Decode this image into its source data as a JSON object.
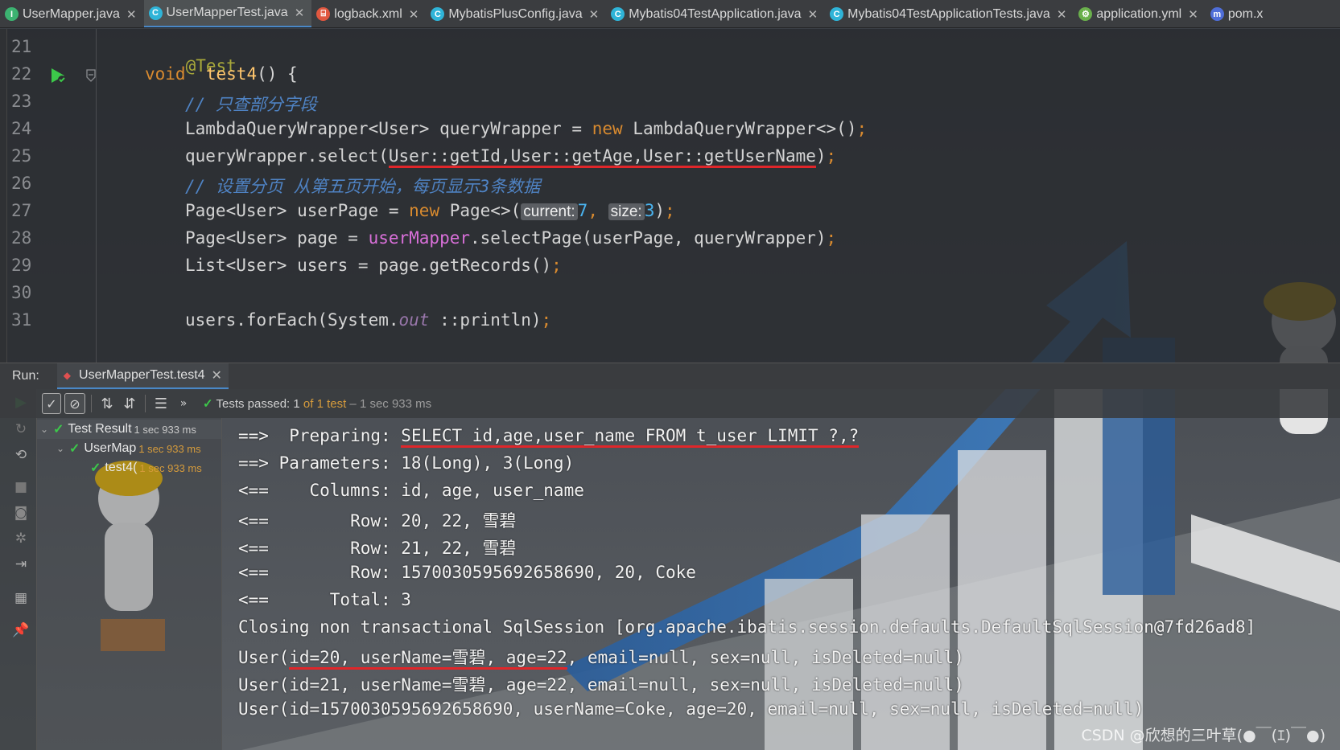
{
  "tabs": [
    {
      "label": "UserMapper.java",
      "icon": "interface-icon",
      "color": "#3cb371",
      "active": false
    },
    {
      "label": "UserMapperTest.java",
      "icon": "class-icon",
      "color": "#2fb4d8",
      "active": true
    },
    {
      "label": "logback.xml",
      "icon": "xml-icon",
      "color": "#e0573f",
      "active": false
    },
    {
      "label": "MybatisPlusConfig.java",
      "icon": "class-icon",
      "color": "#2fb4d8",
      "active": false
    },
    {
      "label": "Mybatis04TestApplication.java",
      "icon": "spring-class-icon",
      "color": "#2fb4d8",
      "active": false
    },
    {
      "label": "Mybatis04TestApplicationTests.java",
      "icon": "class-icon",
      "color": "#2fb4d8",
      "active": false
    },
    {
      "label": "application.yml",
      "icon": "spring-yml-icon",
      "color": "#6ab04c",
      "active": false
    },
    {
      "label": "pom.x",
      "icon": "maven-icon",
      "color": "#4f6ed8",
      "active": false
    }
  ],
  "editor": {
    "line_numbers": [
      "21",
      "22",
      "23",
      "24",
      "25",
      "26",
      "27",
      "28",
      "29",
      "30",
      "31"
    ],
    "code": {
      "l21_ann": "@Test",
      "l22_kw": "void",
      "l22_fn": "test4",
      "l22_rest": "() {",
      "l23_comment": "// 只查部分字段",
      "l24_a": "LambdaQueryWrapper<User> queryWrapper = ",
      "l24_kw": "new",
      "l24_b": " LambdaQueryWrapper<>()",
      "l24_semi": ";",
      "l25_a": "queryWrapper.select(",
      "l25_u": "User::getId,User::getAge,User::getUserName",
      "l25_b": ")",
      "l25_semi": ";",
      "l26_comment": "// 设置分页 从第五页开始，每页显示3条数据",
      "l27_a": "Page<User> userPage = ",
      "l27_kw": "new",
      "l27_b": " Page<>(",
      "l27_hint1": "current:",
      "l27_v1": "7",
      "l27_comma": ",",
      "l27_hint2": "size:",
      "l27_v2": "3",
      "l27_c": ")",
      "l27_semi": ";",
      "l28_a": "Page<User> page = ",
      "l28_fld": "userMapper",
      "l28_b": ".selectPage(userPage, queryWrapper)",
      "l28_semi": ";",
      "l29_a": "List<User> users = page.getRecords()",
      "l29_semi": ";",
      "l31_a": "users.forEach(System.",
      "l31_stat": "out",
      "l31_b": " ::println)",
      "l31_semi": ";"
    }
  },
  "run": {
    "label": "Run:",
    "tab_label": "UserMapperTest.test4",
    "status_prefix": "Tests passed: ",
    "status_count": "1",
    "status_of": " of 1 test",
    "status_time": " – 1 sec 933 ms"
  },
  "tree": {
    "root_label": "Test Result",
    "root_time": "1 sec 933 ms",
    "class_label": "UserMap",
    "class_time": "1 sec 933 ms",
    "method_label": "test4(",
    "method_time": "1 sec 933 ms"
  },
  "console": {
    "lines": [
      "==>  Preparing: ",
      "==> Parameters: 18(Long), 3(Long)",
      "<==    Columns: id, age, user_name",
      "<==        Row: 20, 22, 雪碧",
      "<==        Row: 21, 22, 雪碧",
      "<==        Row: 1570030595692658690, 20, Coke",
      "<==      Total: 3",
      "Closing non transactional SqlSession [org.apache.ibatis.session.defaults.DefaultSqlSession@7fd26ad8]",
      "User(",
      "User(id=21, userName=雪碧, age=22, email=null, sex=null, isDeleted=null)",
      "User(id=1570030595692658690, userName=Coke, age=20, email=null, sex=null, isDeleted=null)"
    ],
    "sql": "SELECT id,age,user_name FROM t_user LIMIT ?,?",
    "line8_ul": "id=20, userName=雪碧, age=22",
    "line8_rest": ", email=null, sex=null, isDeleted=null)"
  },
  "watermark": "CSDN @欣想的三叶草(●￣(ｴ)￣●)",
  "colors": {
    "accent": "#4a88c7",
    "pass": "#3cc84a",
    "underline": "#e0262a"
  }
}
